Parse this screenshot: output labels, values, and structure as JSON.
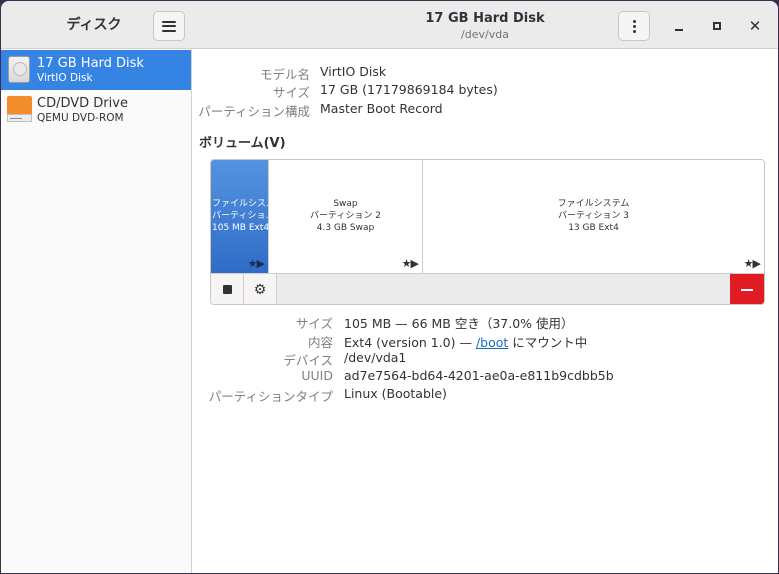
{
  "sidebar": {
    "title": "ディスク",
    "drives": [
      {
        "name": "17 GB Hard Disk",
        "sub": "VirtIO Disk"
      },
      {
        "name": "CD/DVD Drive",
        "sub": "QEMU DVD-ROM"
      }
    ]
  },
  "header": {
    "title": "17 GB Hard Disk",
    "subtitle": "/dev/vda"
  },
  "disk_info": {
    "model_label": "モデル名",
    "model_value": "VirtIO Disk",
    "size_label": "サイズ",
    "size_value": "17 GB (17179869184 bytes)",
    "partitioning_label": "パーティション構成",
    "partitioning_value": "Master Boot Record"
  },
  "volumes": {
    "heading": "ボリューム(V)",
    "partitions": [
      {
        "line1": "ファイルシス…",
        "line2": "パーティショ…",
        "line3": "105 MB Ext4",
        "stars": "★▶"
      },
      {
        "line1": "Swap",
        "line2": "パーティション 2",
        "line3": "4.3 GB Swap",
        "stars": "★▶"
      },
      {
        "line1": "ファイルシステム",
        "line2": "パーティション 3",
        "line3": "13 GB Ext4",
        "stars": "★▶"
      }
    ]
  },
  "selected_volume": {
    "size_label": "サイズ",
    "size_value": "105 MB — 66 MB 空き（37.0% 使用）",
    "contents_label": "内容",
    "contents_prefix": "Ext4 (version 1.0) — ",
    "contents_link": "/boot",
    "contents_suffix": " にマウント中",
    "device_label": "デバイス",
    "device_value": "/dev/vda1",
    "uuid_label": "UUID",
    "uuid_value": "ad7e7564-bd64-4201-ae0a-e811b9cdbb5b",
    "ptype_label": "パーティションタイプ",
    "ptype_value": "Linux (Bootable)"
  },
  "colors": {
    "accent": "#3584e4",
    "danger": "#e01b24",
    "link": "#1b6acb"
  },
  "icons": [
    "hamburger-icon",
    "kebab-icon",
    "minimize-icon",
    "maximize-icon",
    "close-icon",
    "stop-icon",
    "gear-icon",
    "minus-icon",
    "hard-disk-icon",
    "optical-drive-icon",
    "star-icon",
    "play-icon"
  ]
}
